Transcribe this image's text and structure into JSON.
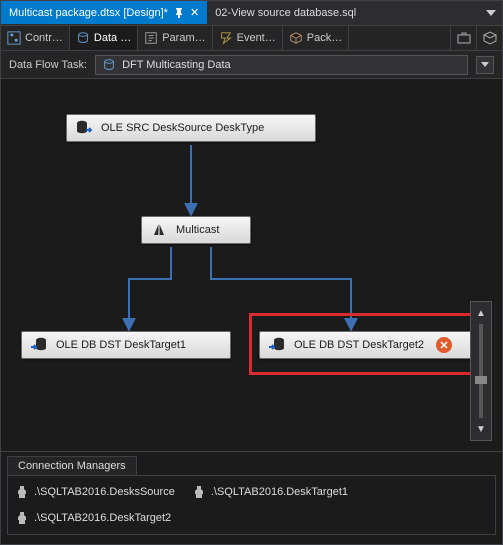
{
  "tabs": {
    "active": {
      "label": "Multicast package.dtsx [Design]*",
      "pinned": true
    },
    "other": {
      "label": "02-View source database.sql"
    }
  },
  "design_tabs": {
    "control": "Contr…",
    "data": "Data …",
    "param": "Param…",
    "event": "Event…",
    "package": "Pack…"
  },
  "dft": {
    "label": "Data Flow Task:",
    "value": "DFT Multicasting Data"
  },
  "nodes": {
    "source": "OLE SRC DeskSource DeskType",
    "multicast": "Multicast",
    "target1": "OLE DB DST DeskTarget1",
    "target2": "OLE DB DST DeskTarget2"
  },
  "connection_managers": {
    "title": "Connection Managers",
    "items": [
      ".\\SQLTAB2016.DesksSource",
      ".\\SQLTAB2016.DeskTarget1",
      ".\\SQLTAB2016.DeskTarget2"
    ]
  }
}
